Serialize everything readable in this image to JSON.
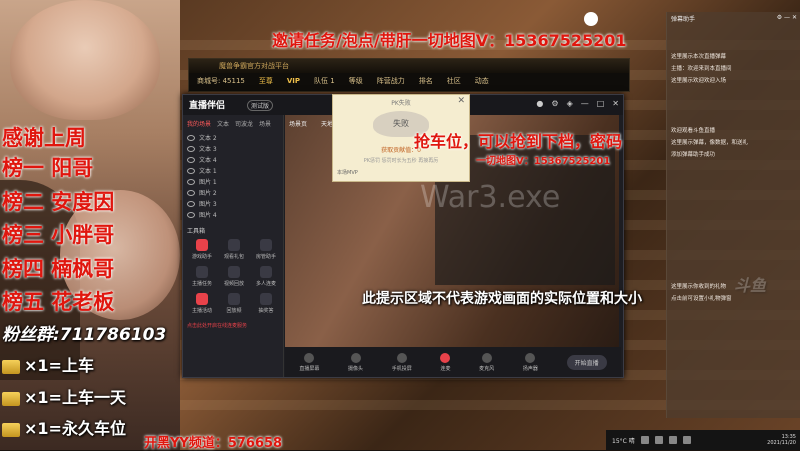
{
  "left_overlay": {
    "thanks_title": "感谢上周",
    "ranks": [
      "榜一 阳哥",
      "榜二 安度因",
      "榜三 小胖哥",
      "榜四 楠枫哥",
      "榜五 花老板"
    ],
    "fan_group": "粉丝群:711786103",
    "rewards": [
      "×1=上车",
      "×1=上车一天",
      "×1=永久车位"
    ],
    "yy_channel": "开黑YY频道：576658"
  },
  "top_banner": "邀请任务/泡点/带肝一切地图V：15367525201",
  "mid_banner": "抢车位，可以抢到下档，密码",
  "mid_small_banner": "一切地图V：15367525201",
  "notice_banner": "此提示区域不代表游戏画面的实际位置和大小",
  "watermark": "War3.exe",
  "game_bar": {
    "title": "魔兽争霸官方对战平台",
    "row2": [
      "商城号: 45115",
      "至尊",
      "VIP",
      "队伍 1",
      "等级",
      "阵营战力",
      "排名",
      "社区",
      "动态"
    ]
  },
  "app": {
    "name": "直播伴侣",
    "version": "测试版",
    "left_tabs": [
      "我的场景",
      "文本",
      "司波龙",
      "场景"
    ],
    "layers": [
      "文本 2",
      "文本 3",
      "文本 4",
      "文本 1",
      "图片 1",
      "图片 2",
      "图片 3",
      "图片 4"
    ],
    "tools_title": "工具箱",
    "tools": [
      {
        "label": "游戏助手",
        "hot": true
      },
      {
        "label": "观看礼包",
        "hot": false
      },
      {
        "label": "房管助手",
        "hot": false
      },
      {
        "label": "主播任务",
        "hot": false
      },
      {
        "label": "视频回放",
        "hot": false
      },
      {
        "label": "多人连麦",
        "hot": false
      },
      {
        "label": "主播活动",
        "hot": true
      },
      {
        "label": "回放频",
        "hot": false
      },
      {
        "label": "抽奖答",
        "hot": false
      }
    ],
    "tip": "点击此处开启在线连麦服务",
    "bottom": [
      {
        "label": "直播屏幕",
        "hot": false
      },
      {
        "label": "摄像头",
        "hot": false
      },
      {
        "label": "手机投屏",
        "hot": false
      },
      {
        "label": "连麦",
        "hot": true
      },
      {
        "label": "麦克风",
        "hot": false
      },
      {
        "label": "扬声器",
        "hot": false
      }
    ],
    "start_button": "开始直播",
    "preview_label": "场景页",
    "preview_label2": "天地"
  },
  "pk_popup": {
    "title": "PK失败",
    "badge": "失败",
    "score": "获取贡献值：0",
    "sub": "PK惩罚 惩罚时长为五秒 再接再厉",
    "mvp": "本场MVP"
  },
  "chat": {
    "title": "弹幕助手",
    "lines": [
      "这里展示本次直播弹幕",
      "主播：欢迎来到本直播间",
      "这里展示欢迎欢迎入场",
      "欢迎观看斗鱼直播",
      "这里展示弹幕，像数据，和送礼",
      "添加弹幕助手成功",
      "这里展示你收到的礼物",
      "点击前可设置小礼物弹窗"
    ]
  },
  "douyu": "斗鱼",
  "taskbar": {
    "weather": "15°C 晴",
    "time": "13:35",
    "date": "2021/11/20"
  }
}
